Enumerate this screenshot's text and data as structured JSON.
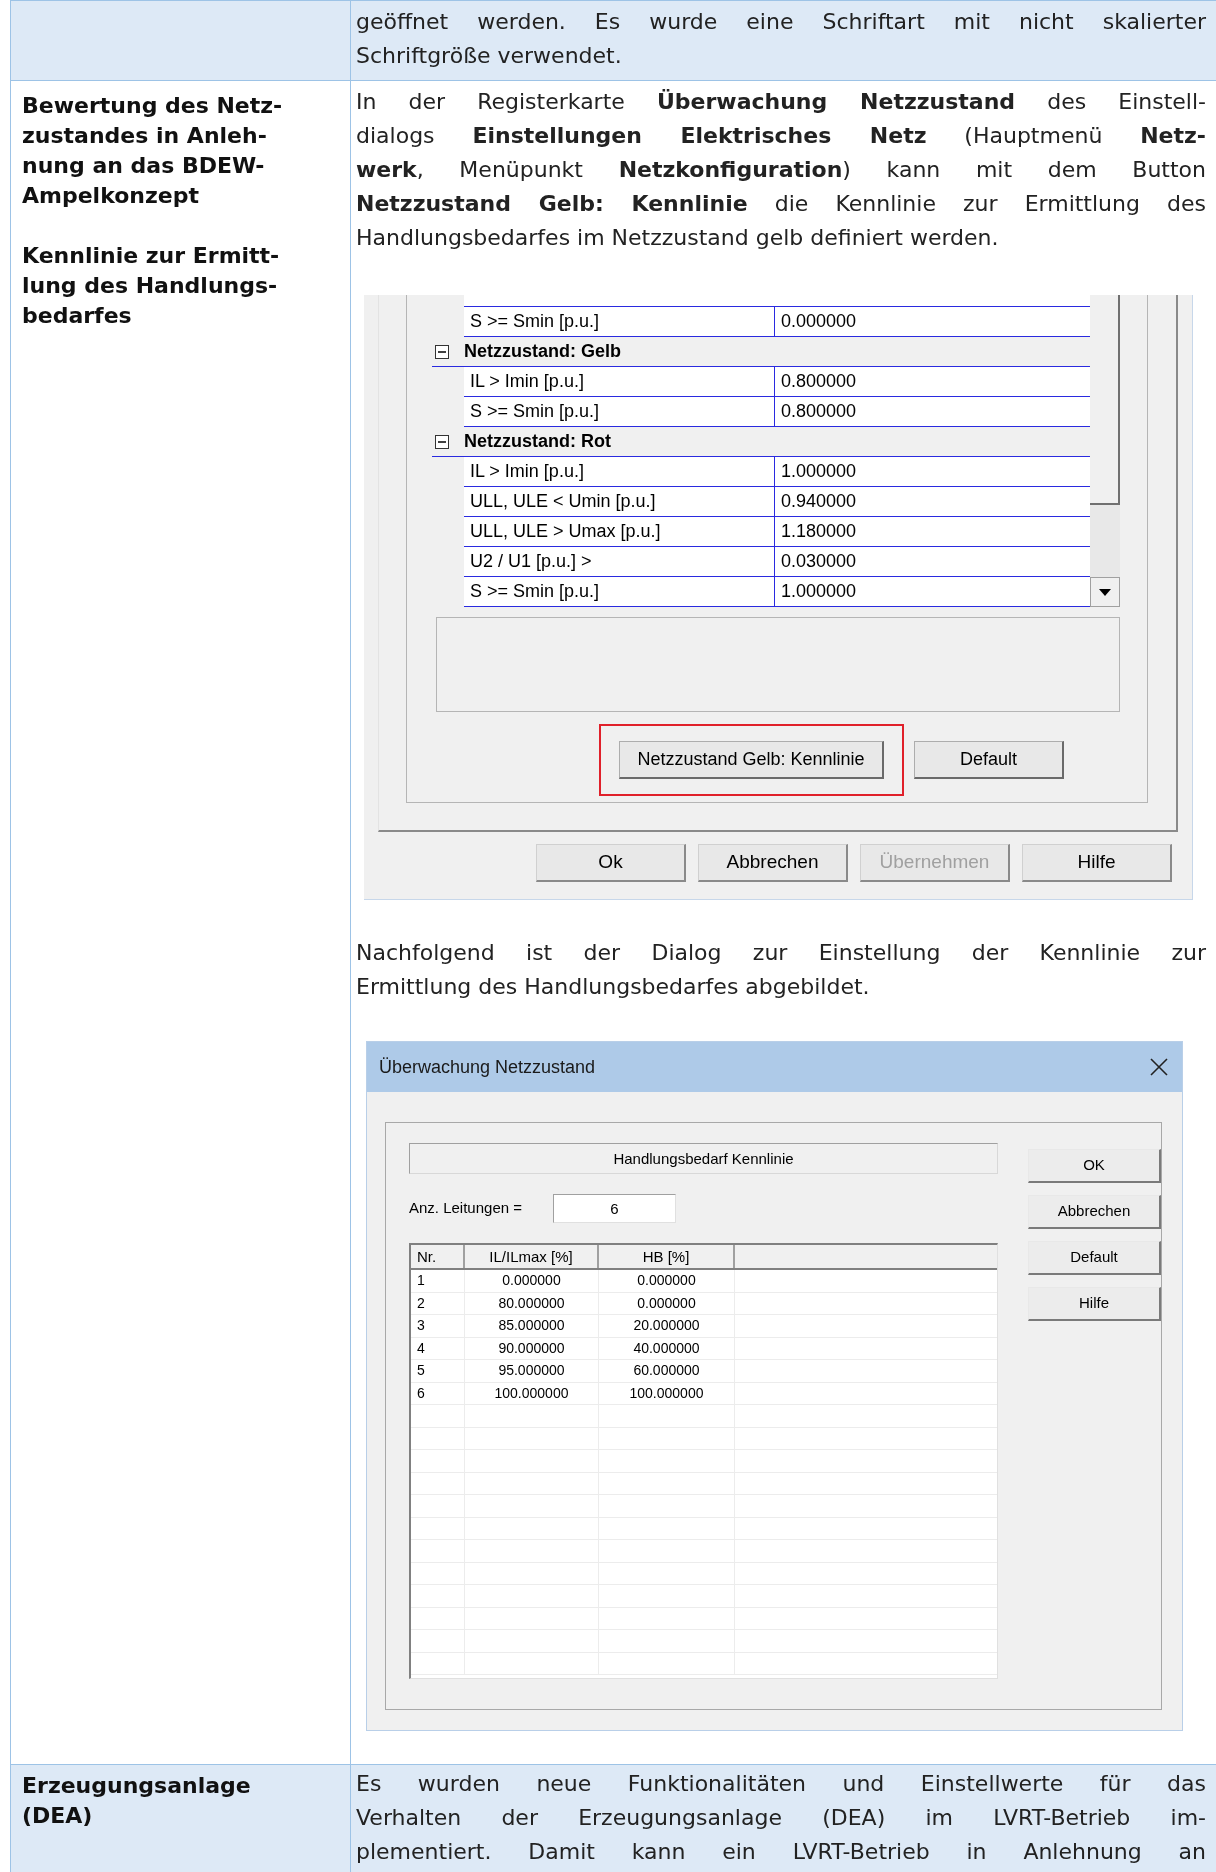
{
  "row_top": {
    "text": {
      "lines": [
        "geöffnet werden. Es wurde eine Schriftart mit nicht skalierter",
        "Schriftgröße verwendet."
      ],
      "complete": true
    }
  },
  "row_monitoring": {
    "headings": [
      [
        "Bewertung des Netz-",
        "zustandes in Anleh-",
        "nung an das BDEW-",
        "Ampelkonzept"
      ],
      [
        "Kennlinie zur Ermitt-",
        "lung des Handlungs-",
        "bedarfes"
      ]
    ],
    "intro": {
      "lines": [
        "In der Registerkarte **Überwachung Netzzustand** des Einstell-",
        "dialogs **Einstellungen Elektrisches Netz** (Hauptmenü **Netz-**",
        "**werk**, Menüpunkt **Netzkonfiguration**) kann mit dem Button",
        "**Netzzustand Gelb: Kennlinie** die Kennlinie zur Ermittlung des",
        "Handlungsbedarfes im Netzzustand gelb definiert werden."
      ],
      "complete": true
    },
    "settings_dialog": {
      "rows": [
        {
          "kind": "param",
          "label": "S >= Smin [p.u.]",
          "value": "0.000000"
        },
        {
          "kind": "group",
          "label": "Netzzustand: Gelb",
          "expanded": true
        },
        {
          "kind": "param",
          "label": "IL > Imin [p.u.]",
          "value": "0.800000"
        },
        {
          "kind": "param",
          "label": "S >= Smin [p.u.]",
          "value": "0.800000"
        },
        {
          "kind": "group",
          "label": "Netzzustand: Rot",
          "expanded": true
        },
        {
          "kind": "param",
          "label": "IL > Imin [p.u.]",
          "value": "1.000000"
        },
        {
          "kind": "param",
          "label": "ULL, ULE < Umin [p.u.]",
          "value": "0.940000"
        },
        {
          "kind": "param",
          "label": "ULL, ULE > Umax [p.u.]",
          "value": "1.180000"
        },
        {
          "kind": "param",
          "label": "U2 / U1 [p.u.] >",
          "value": "0.030000"
        },
        {
          "kind": "param",
          "label": "S >= Smin [p.u.]",
          "value": "1.000000"
        }
      ],
      "panel_buttons": [
        {
          "label": "Netzzustand Gelb: Kennlinie",
          "highlighted": true
        },
        {
          "label": "Default",
          "highlighted": false
        }
      ],
      "footer_buttons": [
        {
          "label": "Ok",
          "disabled": false
        },
        {
          "label": "Abbrechen",
          "disabled": false
        },
        {
          "label": "Übernehmen",
          "disabled": true
        },
        {
          "label": "Hilfe",
          "disabled": false
        }
      ]
    },
    "caption": {
      "lines": [
        "Nachfolgend ist der Dialog zur Einstellung der Kennlinie zur",
        "Ermittlung des Handlungsbedarfes abgebildet."
      ],
      "complete": true
    },
    "curve_dialog": {
      "title": "Überwachung Netzzustand",
      "group_label": "Handlungsbedarf Kennlinie",
      "count_label": "Anz. Leitungen =",
      "count_value": "6",
      "columns": [
        "Nr.",
        "IL/ILmax [%]",
        "HB [%]"
      ],
      "rows": [
        [
          "1",
          "0.000000",
          "0.000000"
        ],
        [
          "2",
          "80.000000",
          "0.000000"
        ],
        [
          "3",
          "85.000000",
          "20.000000"
        ],
        [
          "4",
          "90.000000",
          "40.000000"
        ],
        [
          "5",
          "95.000000",
          "60.000000"
        ],
        [
          "6",
          "100.000000",
          "100.000000"
        ]
      ],
      "buttons": [
        "OK",
        "Abbrechen",
        "Default",
        "Hilfe"
      ]
    }
  },
  "row_generation": {
    "heading": [
      "Erzeugungsanlage",
      "(DEA)"
    ],
    "text": {
      "lines": [
        "Es wurden neue Funktionalitäten und Einstellwerte für das",
        "Verhalten der Erzeugungsanlage (DEA) im LVRT-Betrieb im-",
        "plementiert. Damit kann ein LVRT-Betrieb in Anlehnung an"
      ],
      "complete": false
    }
  }
}
